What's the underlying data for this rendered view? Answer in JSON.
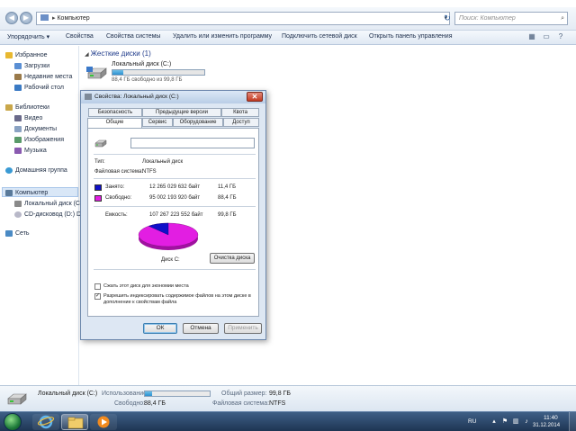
{
  "address_bar": {
    "path_segment": "Компьютер",
    "search_placeholder": "Поиск: Компьютер"
  },
  "toolbar": {
    "items": [
      "Упорядочить ▾",
      "Свойства",
      "Свойства системы",
      "Удалить или изменить программу",
      "Подключить сетевой диск",
      "Открыть панель управления"
    ]
  },
  "sidebar": {
    "favorites": "Избранное",
    "downloads": "Загрузки",
    "recent": "Недавние места",
    "desktop": "Рабочий стол",
    "libraries": "Библиотеки",
    "video": "Видео",
    "documents": "Документы",
    "images": "Изображения",
    "music": "Музыка",
    "homegroup": "Домашняя группа",
    "computer": "Компьютер",
    "local_disk": "Локальный диск (C:)",
    "cd_drive": "CD-дисковод (D:) D",
    "network": "Сеть"
  },
  "main": {
    "section_title": "Жесткие диски (1)",
    "drive_name": "Локальный диск (C:)",
    "drive_free_text": "88,4 ГБ свободно из 99,8 ГБ",
    "drive_used_fraction": 0.114
  },
  "dialog": {
    "title": "Свойства: Локальный диск (C:)",
    "close": "✕",
    "tabs_row1": [
      "Безопасность",
      "Предыдущие версии",
      "Квота"
    ],
    "tabs_row2": [
      "Общие",
      "Сервис",
      "Оборудование",
      "Доступ"
    ],
    "label_value": "",
    "type_label": "Тип:",
    "type_value": "Локальный диск",
    "fs_label": "Файловая система:",
    "fs_value": "NTFS",
    "used_label": "Занято:",
    "used_bytes": "12 265 029 632 байт",
    "used_gb": "11,4 ГБ",
    "free_label": "Свободно:",
    "free_bytes": "95 002 193 920 байт",
    "free_gb": "88,4 ГБ",
    "capacity_label": "Емкость:",
    "capacity_bytes": "107 267 223 552 байт",
    "capacity_gb": "99,8 ГБ",
    "disk_label": "Диск C:",
    "cleanup_button": "Очистка диска",
    "compress_label": "Сжать этот диск для экономии места",
    "index_label": "Разрешить индексировать содержимое файлов на этом диске в дополнение к свойствам файла",
    "index_checked": "✓",
    "ok": "ОК",
    "cancel": "Отмена",
    "apply": "Применить",
    "used_color": "#1010c8",
    "free_color": "#e21ee2"
  },
  "details": {
    "drive_name": "Локальный диск (C:)",
    "usage_label": "Использование:",
    "free_label": "Свободно:",
    "free_value": "88,4 ГБ",
    "total_label": "Общий размер:",
    "total_value": "99,8 ГБ",
    "fs_label": "Файловая система:",
    "fs_value": "NTFS",
    "used_fraction": 0.114
  },
  "taskbar": {
    "language": "RU",
    "time": "11:40",
    "date": "31.12.2014"
  }
}
